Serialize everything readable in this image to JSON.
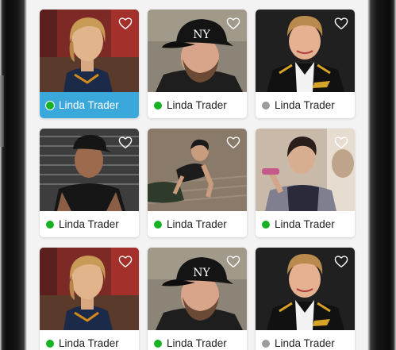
{
  "profiles": [
    {
      "name": "Linda Trader",
      "status": "online",
      "selected": true
    },
    {
      "name": "Linda Trader",
      "status": "online",
      "selected": false
    },
    {
      "name": "Linda Trader",
      "status": "offline",
      "selected": false
    },
    {
      "name": "Linda Trader",
      "status": "online",
      "selected": false
    },
    {
      "name": "Linda Trader",
      "status": "online",
      "selected": false
    },
    {
      "name": "Linda Trader",
      "status": "online",
      "selected": false
    },
    {
      "name": "Linda Trader",
      "status": "online",
      "selected": false
    },
    {
      "name": "Linda Trader",
      "status": "online",
      "selected": false
    },
    {
      "name": "Linda Trader",
      "status": "offline",
      "selected": false
    }
  ],
  "colors": {
    "selected_footer": "#3ba8dc",
    "online": "#17b223",
    "offline": "#9c9c9c"
  },
  "icons": {
    "favorite": "heart-outline-icon"
  }
}
